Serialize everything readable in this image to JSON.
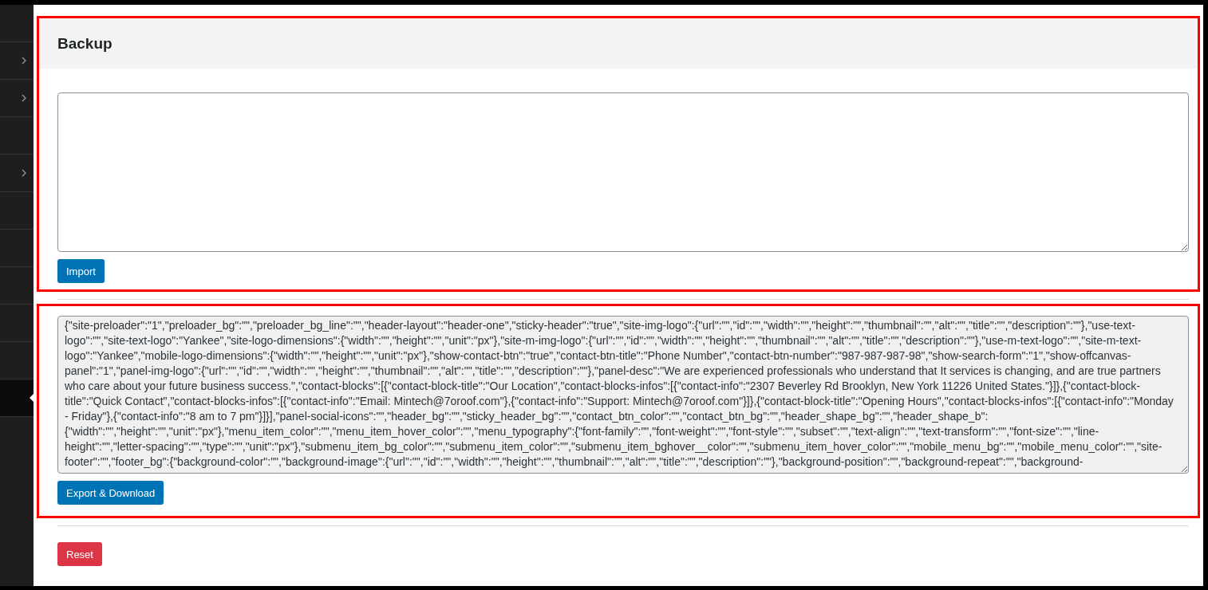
{
  "sidebar": {
    "items": [
      {
        "has_submenu": false,
        "selected": false
      },
      {
        "has_submenu": true,
        "selected": false
      },
      {
        "has_submenu": true,
        "selected": false
      },
      {
        "has_submenu": false,
        "selected": false
      },
      {
        "has_submenu": true,
        "selected": false
      },
      {
        "has_submenu": false,
        "selected": false
      },
      {
        "has_submenu": false,
        "selected": false
      },
      {
        "has_submenu": false,
        "selected": false
      },
      {
        "has_submenu": false,
        "selected": false
      },
      {
        "has_submenu": false,
        "selected": false
      },
      {
        "has_submenu": false,
        "selected": true
      }
    ]
  },
  "import_section": {
    "title": "Backup",
    "highlighted": true,
    "button": "Import"
  },
  "export_section": {
    "highlighted": true,
    "textarea": {
      "value": "{\"site-preloader\":\"1\",\"preloader_bg\":\"\",\"preloader_bg_line\":\"\",\"header-layout\":\"header-one\",\"sticky-header\":\"true\",\"site-img-logo\":{\"url\":\"\",\"id\":\"\",\"width\":\"\",\"height\":\"\",\"thumbnail\":\"\",\"alt\":\"\",\"title\":\"\",\"description\":\"\"},\"use-text-logo\":\"\",\"site-text-logo\":\"Yankee\",\"site-logo-dimensions\":{\"width\":\"\",\"height\":\"\",\"unit\":\"px\"},\"site-m-img-logo\":{\"url\":\"\",\"id\":\"\",\"width\":\"\",\"height\":\"\",\"thumbnail\":\"\",\"alt\":\"\",\"title\":\"\",\"description\":\"\"},\"use-m-text-logo\":\"\",\"site-m-text-logo\":\"Yankee\",\"mobile-logo-dimensions\":{\"width\":\"\",\"height\":\"\",\"unit\":\"px\"},\"show-contact-btn\":\"true\",\"contact-btn-title\":\"Phone Number\",\"contact-btn-number\":\"987-987-987-98\",\"show-search-form\":\"1\",\"show-offcanvas-panel\":\"1\",\"panel-img-logo\":{\"url\":\"\",\"id\":\"\",\"width\":\"\",\"height\":\"\",\"thumbnail\":\"\",\"alt\":\"\",\"title\":\"\",\"description\":\"\"},\"panel-desc\":\"We are experienced professionals who understand that It services is changing, and are true partners who care about your future business success.\",\"contact-blocks\":[{\"contact-block-title\":\"Our Location\",\"contact-blocks-infos\":[{\"contact-info\":\"2307 Beverley Rd Brooklyn, New York 11226 United States.\"}]},{\"contact-block-title\":\"Quick Contact\",\"contact-blocks-infos\":[{\"contact-info\":\"Email: Mintech@7oroof.com\"},{\"contact-info\":\"Support: Mintech@7oroof.com\"}]},{\"contact-block-title\":\"Opening Hours\",\"contact-blocks-infos\":[{\"contact-info\":\"Monday - Friday\"},{\"contact-info\":\"8 am to 7 pm\"}]}],\"panel-social-icons\":\"\",\"header_bg\":\"\",\"sticky_header_bg\":\"\",\"contact_btn_color\":\"\",\"contact_btn_bg\":\"\",\"header_shape_bg\":\"\",\"header_shape_b\":{\"width\":\"\",\"height\":\"\",\"unit\":\"px\"},\"menu_item_color\":\"\",\"menu_item_hover_color\":\"\",\"menu_typography\":{\"font-family\":\"\",\"font-weight\":\"\",\"font-style\":\"\",\"subset\":\"\",\"text-align\":\"\",\"text-transform\":\"\",\"font-size\":\"\",\"line-height\":\"\",\"letter-spacing\":\"\",\"type\":\"\",\"unit\":\"px\"},\"submenu_item_bg_color\":\"\",\"submenu_item_color\":\"\",\"submenu_item_bghover__color\":\"\",\"submenu_item_hover_color\":\"\",\"mobile_menu_bg\":\"\",\"mobile_menu_color\":\"\",\"site-footer\":\"\",\"footer_bg\":{\"background-color\":\"\",\"background-image\":{\"url\":\"\",\"id\":\"\",\"width\":\"\",\"height\":\"\",\"thumbnail\":\"\",\"alt\":\"\",\"title\":\"\",\"description\":\"\"},\"background-position\":\"\",\"background-repeat\":\"\",\"background-",
      "readonly": true
    },
    "button": "Export & Download"
  },
  "reset_button": "Reset"
}
